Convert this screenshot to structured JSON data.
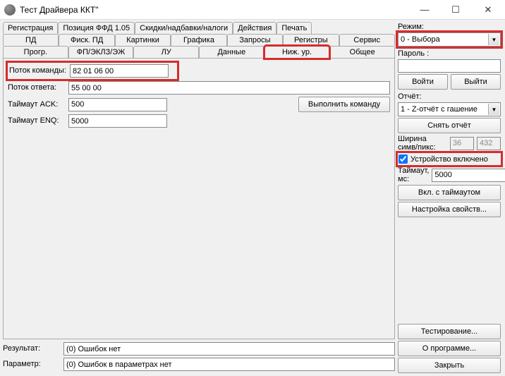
{
  "window": {
    "title": "Тест Драйвера ККТ\""
  },
  "tabs": {
    "row1": [
      "Регистрация",
      "Позиция ФФД 1.05",
      "Скидки/надбавки/налоги",
      "Действия",
      "Печать"
    ],
    "row2": [
      "ПД",
      "Фиск. ПД",
      "Картинки",
      "Графика",
      "Запросы",
      "Регистры",
      "Сервис"
    ],
    "row3": [
      "Прогр.",
      "ФП/ЭКЛЗ/ЭЖ",
      "ЛУ",
      "Данные",
      "Ниж. ур.",
      "Общее"
    ]
  },
  "form": {
    "cmd_stream_label": "Поток команды:",
    "cmd_stream_value": "82 01 06 00",
    "ans_stream_label": "Поток ответа:",
    "ans_stream_value": "55 00 00",
    "ack_label": "Таймаут ACK:",
    "ack_value": "500",
    "enq_label": "Таймаут ENQ:",
    "enq_value": "5000",
    "exec_btn": "Выполнить команду"
  },
  "bottom": {
    "result_label": "Результат:",
    "result_value": "(0) Ошибок нет",
    "param_label": "Параметр:",
    "param_value": "(0) Ошибок в параметрах нет"
  },
  "right": {
    "mode_label": "Режим:",
    "mode_value": "0 - Выбора",
    "password_label": "Пароль :",
    "password_value": "",
    "login_btn": "Войти",
    "logout_btn": "Выйти",
    "report_label": "Отчёт:",
    "report_value": "1 - Z-отчёт с гашение",
    "take_report_btn": "Снять отчёт",
    "width_label": "Ширина симв/пикс:",
    "width_chars": "36",
    "width_px": "432",
    "device_on_label": "Устройство включено",
    "timeout_label": "Таймаут, мс:",
    "timeout_value": "5000",
    "on_timeout_btn": "Вкл. с таймаутом",
    "props_btn": "Настройка свойств...",
    "test_btn": "Тестирование...",
    "about_btn": "О программе...",
    "close_btn": "Закрыть"
  }
}
